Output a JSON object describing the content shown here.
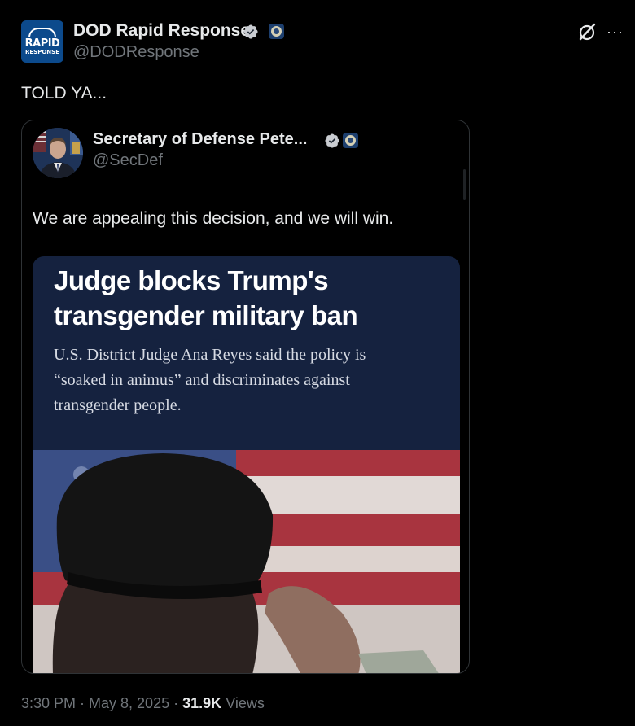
{
  "post": {
    "author_name": "DOD Rapid Response",
    "author_handle": "@DODResponse",
    "avatar_text_1": "RAPID",
    "avatar_text_2": "RESPONSE",
    "text": "TOLD YA...",
    "timestamp": "3:30 PM · May 8, 2025",
    "separator": "·",
    "views_count": "31.9K",
    "views_label": "Views"
  },
  "quoted": {
    "author_name": "Secretary of Defense Pete...",
    "author_handle": "@SecDef",
    "text": "We are appealing this decision, and we will win."
  },
  "article": {
    "headline": "Judge blocks Trump's transgender military ban",
    "dek": "U.S. District Judge Ana Reyes said the policy is “soaked in animus” and discriminates against transgender people."
  },
  "icons": {
    "verified": "verified-badge-icon",
    "seal": "dod-seal-icon",
    "grok": "grok-icon",
    "more": "more-icon"
  },
  "colors": {
    "verified": "#1d9bf0",
    "background": "#000000",
    "muted_text": "#71767b",
    "headline_bg": "#15223f"
  }
}
